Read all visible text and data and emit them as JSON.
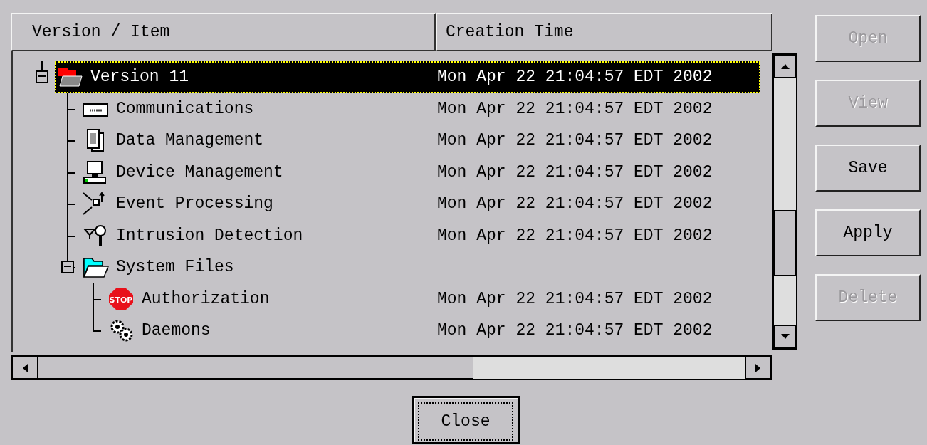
{
  "table": {
    "columns": [
      "Version / Item",
      "Creation Time"
    ],
    "rows": [
      {
        "label": "Version 11",
        "time": "Mon Apr 22 21:04:57 EDT 2002",
        "selected": true,
        "expanded": true,
        "children": [
          {
            "label": "Communications",
            "time": "Mon Apr 22 21:04:57 EDT 2002",
            "selected": false
          },
          {
            "label": "Data Management",
            "time": "Mon Apr 22 21:04:57 EDT 2002",
            "selected": false
          },
          {
            "label": "Device Management",
            "time": "Mon Apr 22 21:04:57 EDT 2002",
            "selected": false
          },
          {
            "label": "Event Processing",
            "time": "Mon Apr 22 21:04:57 EDT 2002",
            "selected": false
          },
          {
            "label": "Intrusion Detection",
            "time": "Mon Apr 22 21:04:57 EDT 2002",
            "selected": false
          },
          {
            "label": "System Files",
            "selected": false,
            "expanded": true,
            "children": [
              {
                "label": "Authorization",
                "time": "Mon Apr 22 21:04:57 EDT 2002",
                "selected": false,
                "icon_text": "STOP"
              },
              {
                "label": "Daemons",
                "time": "Mon Apr 22 21:04:57 EDT 2002",
                "selected": false
              }
            ]
          }
        ]
      }
    ]
  },
  "buttons": [
    {
      "label": "Open",
      "disabled": true
    },
    {
      "label": "View",
      "disabled": true
    },
    {
      "label": "Save",
      "disabled": false
    },
    {
      "label": "Apply",
      "disabled": false
    },
    {
      "label": "Delete",
      "disabled": true
    }
  ],
  "close_button": {
    "label": "Close"
  }
}
